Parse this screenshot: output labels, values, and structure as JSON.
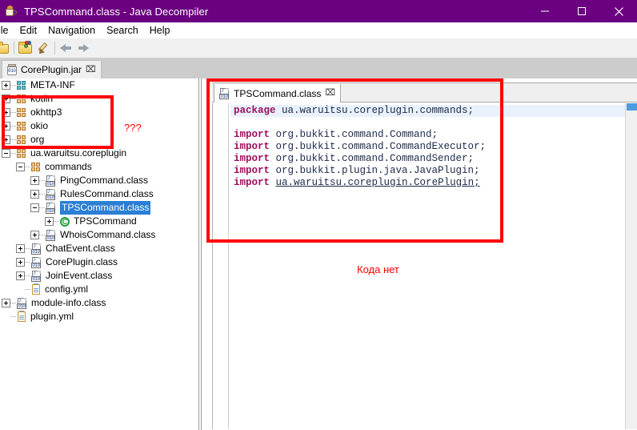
{
  "window": {
    "title": "TPSCommand.class - Java Decompiler",
    "app_icon": "java-coffee-cup-icon",
    "accent_color": "#6b0080",
    "controls": {
      "minimize": "minimize-button",
      "maximize": "maximize-button",
      "close": "close-button"
    }
  },
  "menubar": {
    "items": [
      {
        "label": "ile"
      },
      {
        "label": "Edit"
      },
      {
        "label": "Navigation"
      },
      {
        "label": "Search"
      },
      {
        "label": "Help"
      }
    ]
  },
  "toolbar": {
    "buttons": [
      {
        "name": "open-file-icon"
      },
      {
        "name": "open-type-icon"
      },
      {
        "name": "save-source-icon"
      },
      {
        "name": "back-arrow-icon"
      },
      {
        "name": "forward-arrow-icon"
      }
    ]
  },
  "jar_tab": {
    "label": "CorePlugin.jar",
    "icon": "jar-file-icon",
    "close": "⌧"
  },
  "tree": {
    "items": [
      {
        "label": "META-INF",
        "depth": 0,
        "expander": "plus",
        "icon": "package-icon-teal",
        "selected": false
      },
      {
        "label": "kotlin",
        "depth": 0,
        "expander": "plus",
        "icon": "package-icon",
        "selected": false
      },
      {
        "label": "okhttp3",
        "depth": 0,
        "expander": "plus",
        "icon": "package-icon",
        "selected": false
      },
      {
        "label": "okio",
        "depth": 0,
        "expander": "plus",
        "icon": "package-icon",
        "selected": false
      },
      {
        "label": "org",
        "depth": 0,
        "expander": "plus",
        "icon": "package-icon",
        "selected": false
      },
      {
        "label": "ua.waruitsu.coreplugin",
        "depth": 0,
        "expander": "minus",
        "icon": "package-icon",
        "selected": false
      },
      {
        "label": "commands",
        "depth": 1,
        "expander": "minus",
        "icon": "package-icon",
        "selected": false
      },
      {
        "label": "PingCommand.class",
        "depth": 2,
        "expander": "plus",
        "icon": "class-file-icon",
        "selected": false
      },
      {
        "label": "RulesCommand.class",
        "depth": 2,
        "expander": "plus",
        "icon": "class-file-icon",
        "selected": false
      },
      {
        "label": "TPSCommand.class",
        "depth": 2,
        "expander": "minus",
        "icon": "class-file-icon",
        "selected": true
      },
      {
        "label": "TPSCommand",
        "depth": 3,
        "expander": "plus",
        "icon": "class-type-icon",
        "selected": false
      },
      {
        "label": "WhoisCommand.class",
        "depth": 2,
        "expander": "plus",
        "icon": "class-file-icon",
        "selected": false
      },
      {
        "label": "ChatEvent.class",
        "depth": 1,
        "expander": "plus",
        "icon": "class-file-icon",
        "selected": false
      },
      {
        "label": "CorePlugin.class",
        "depth": 1,
        "expander": "plus",
        "icon": "class-file-icon",
        "selected": false
      },
      {
        "label": "JoinEvent.class",
        "depth": 1,
        "expander": "plus",
        "icon": "class-file-icon",
        "selected": false
      },
      {
        "label": "config.yml",
        "depth": 1,
        "expander": "none",
        "icon": "yml-file-icon",
        "selected": false
      },
      {
        "label": "module-info.class",
        "depth": 0,
        "expander": "plus",
        "icon": "class-file-icon",
        "selected": false
      },
      {
        "label": "plugin.yml",
        "depth": 0,
        "expander": "none",
        "icon": "yml-file-icon",
        "selected": false
      }
    ]
  },
  "editor": {
    "tab": {
      "label": "TPSCommand.class",
      "icon": "class-file-icon",
      "close": "⌧"
    },
    "code_lines": [
      {
        "current": true,
        "parts": [
          {
            "t": "package",
            "style": "kw"
          },
          {
            "t": " ua.waruitsu.coreplugin.commands;",
            "style": ""
          }
        ]
      },
      {
        "current": false,
        "parts": [
          {
            "t": "",
            "style": ""
          }
        ]
      },
      {
        "current": false,
        "parts": [
          {
            "t": "import",
            "style": "kw"
          },
          {
            "t": " org.bukkit.command.Command;",
            "style": ""
          }
        ]
      },
      {
        "current": false,
        "parts": [
          {
            "t": "import",
            "style": "kw"
          },
          {
            "t": " org.bukkit.command.CommandExecutor;",
            "style": ""
          }
        ]
      },
      {
        "current": false,
        "parts": [
          {
            "t": "import",
            "style": "kw"
          },
          {
            "t": " org.bukkit.command.CommandSender;",
            "style": ""
          }
        ]
      },
      {
        "current": false,
        "parts": [
          {
            "t": "import",
            "style": "kw"
          },
          {
            "t": " org.bukkit.plugin.java.JavaPlugin;",
            "style": ""
          }
        ]
      },
      {
        "current": false,
        "parts": [
          {
            "t": "import",
            "style": "kw"
          },
          {
            "t": " ",
            "style": ""
          },
          {
            "t": "ua.waruitsu.coreplugin.CorePlugin;",
            "style": "link"
          }
        ]
      }
    ]
  },
  "annotations": {
    "color": "#ff0000",
    "tree_box_label": "???",
    "editor_box_label": "Кода нет"
  }
}
